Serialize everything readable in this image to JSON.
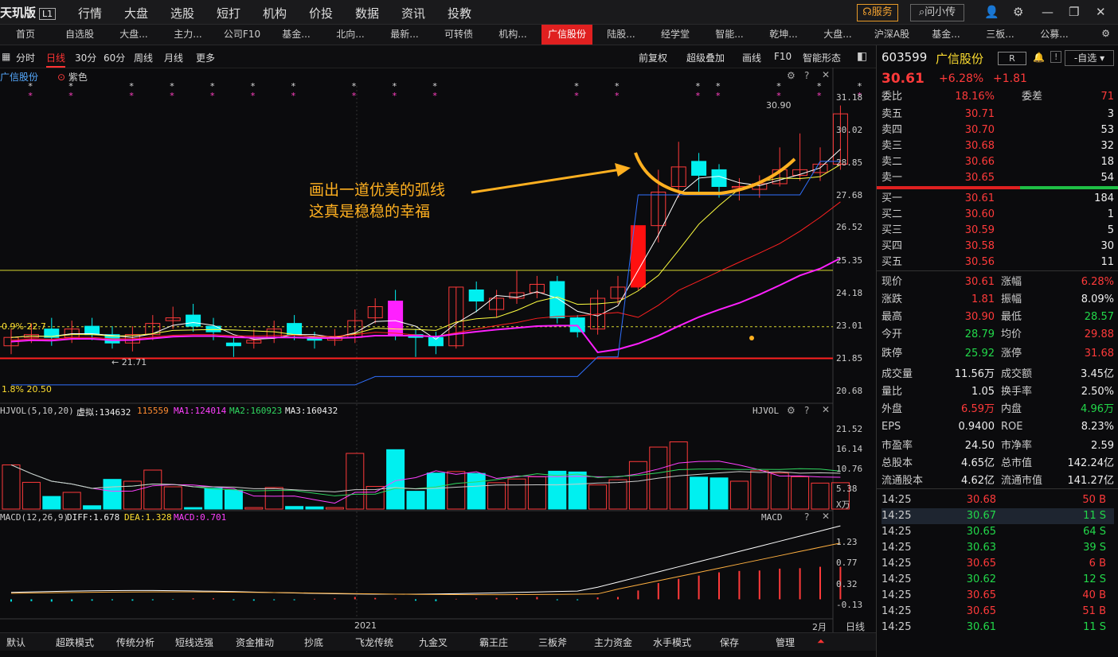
{
  "app": {
    "brand": "天玑版",
    "level": "L1",
    "menu": [
      "行情",
      "大盘",
      "选股",
      "短打",
      "机构",
      "价投",
      "数据",
      "资讯",
      "投教"
    ],
    "service": "服务",
    "ask": "问小传"
  },
  "tabs": [
    "首页",
    "自选股",
    "大盘...",
    "主力...",
    "公司F10",
    "基金...",
    "北向...",
    "最新...",
    "可转债",
    "机构...",
    "广信股份",
    "陆股...",
    "经学堂",
    "智能...",
    "乾坤...",
    "大盘...",
    "沪深A股",
    "基金...",
    "三板...",
    "公募..."
  ],
  "active_tab": "广信股份",
  "toolbar": {
    "periods": [
      "分时",
      "日线",
      "30分",
      "60分",
      "周线",
      "月线",
      "更多"
    ],
    "active": "日线",
    "right": [
      "前复权",
      "超级叠加",
      "画线",
      "F10",
      "智能形态"
    ]
  },
  "chart": {
    "stock": "广信股份",
    "color_mode": "紫色",
    "annotation_line1": "画出一道优美的弧线",
    "annotation_line2": "这真是稳稳的幸福",
    "high_label": "30.90",
    "low_label": "21.71",
    "left_pct1": "0.9% 22.7",
    "left_pct2": "1.8% 20.50",
    "year_label": "2021",
    "month_label": "2月",
    "period_label": "日线",
    "price_ticks": [
      "31.18",
      "30.02",
      "28.85",
      "27.68",
      "26.52",
      "25.35",
      "24.18",
      "23.01",
      "21.85",
      "20.68"
    ],
    "vol": {
      "name": "HJVOL(5,10,20)",
      "virtual": "虚拟:134632",
      "v2": "115559",
      "ma1": "MA1:124014",
      "ma2": "MA2:160923",
      "ma3": "MA3:160432",
      "tag": "HJVOL",
      "ticks": [
        "21.52",
        "16.14",
        "10.76",
        "5.38"
      ],
      "unit": "X万"
    },
    "macd": {
      "name": "MACD(12,26,9)",
      "diff": "DIFF:1.678",
      "dea": "DEA:1.328",
      "macd": "MACD:0.701",
      "tag": "MACD",
      "ticks": [
        "1.23",
        "0.77",
        "0.32",
        "-0.13"
      ]
    }
  },
  "chart_data": {
    "type": "candlestick",
    "candles": [
      {
        "o": 22.3,
        "c": 22.6,
        "h": 22.9,
        "l": 22.0
      },
      {
        "o": 22.6,
        "c": 22.7,
        "h": 23.1,
        "l": 22.4
      },
      {
        "o": 22.9,
        "c": 22.6,
        "h": 23.3,
        "l": 22.3
      },
      {
        "o": 22.6,
        "c": 22.9,
        "h": 23.2,
        "l": 22.4
      },
      {
        "o": 23.0,
        "c": 22.7,
        "h": 23.3,
        "l": 22.5
      },
      {
        "o": 22.7,
        "c": 22.4,
        "h": 23.0,
        "l": 22.2
      },
      {
        "o": 22.4,
        "c": 22.7,
        "h": 23.0,
        "l": 22.1
      },
      {
        "o": 22.7,
        "c": 23.1,
        "h": 23.4,
        "l": 22.5
      },
      {
        "o": 23.2,
        "c": 23.3,
        "h": 23.7,
        "l": 22.9
      },
      {
        "o": 23.4,
        "c": 23.0,
        "h": 23.8,
        "l": 22.8
      },
      {
        "o": 23.0,
        "c": 22.8,
        "h": 23.3,
        "l": 22.5
      },
      {
        "o": 22.4,
        "c": 22.3,
        "h": 22.6,
        "l": 21.9
      },
      {
        "o": 22.4,
        "c": 22.5,
        "h": 22.9,
        "l": 22.2
      },
      {
        "o": 22.6,
        "c": 22.9,
        "h": 23.2,
        "l": 22.4
      },
      {
        "o": 23.1,
        "c": 22.7,
        "h": 23.4,
        "l": 22.5
      },
      {
        "o": 22.6,
        "c": 22.5,
        "h": 22.8,
        "l": 22.2
      },
      {
        "o": 22.5,
        "c": 22.6,
        "h": 22.9,
        "l": 22.3
      },
      {
        "o": 22.6,
        "c": 23.2,
        "h": 23.6,
        "l": 22.4
      },
      {
        "o": 23.3,
        "c": 23.7,
        "h": 24.0,
        "l": 23.1
      },
      {
        "o": 23.9,
        "c": 22.7,
        "h": 24.3,
        "l": 22.5
      },
      {
        "o": 22.7,
        "c": 22.6,
        "h": 22.9,
        "l": 21.9
      },
      {
        "o": 22.6,
        "c": 22.3,
        "h": 22.8,
        "l": 22.0
      },
      {
        "o": 22.3,
        "c": 24.4,
        "h": 24.4,
        "l": 22.2
      },
      {
        "o": 24.3,
        "c": 23.9,
        "h": 24.6,
        "l": 23.5
      },
      {
        "o": 23.6,
        "c": 24.0,
        "h": 24.3,
        "l": 23.3
      },
      {
        "o": 24.0,
        "c": 24.2,
        "h": 25.0,
        "l": 23.8
      },
      {
        "o": 24.2,
        "c": 24.5,
        "h": 24.8,
        "l": 24.0
      },
      {
        "o": 24.6,
        "c": 23.3,
        "h": 24.8,
        "l": 23.1
      },
      {
        "o": 23.3,
        "c": 22.8,
        "h": 23.4,
        "l": 22.6
      },
      {
        "o": 22.9,
        "c": 24.0,
        "h": 24.3,
        "l": 22.7
      },
      {
        "o": 24.0,
        "c": 24.4,
        "h": 24.8,
        "l": 23.8
      },
      {
        "o": 24.4,
        "c": 26.6,
        "h": 26.6,
        "l": 24.3
      },
      {
        "o": 26.6,
        "c": 27.8,
        "h": 28.6,
        "l": 26.0
      },
      {
        "o": 28.0,
        "c": 28.7,
        "h": 29.6,
        "l": 27.6
      },
      {
        "o": 28.9,
        "c": 28.4,
        "h": 29.2,
        "l": 27.8
      },
      {
        "o": 28.6,
        "c": 28.0,
        "h": 28.8,
        "l": 27.6
      },
      {
        "o": 28.0,
        "c": 28.0,
        "h": 28.3,
        "l": 27.5
      },
      {
        "o": 27.9,
        "c": 28.1,
        "h": 28.4,
        "l": 27.6
      },
      {
        "o": 28.1,
        "c": 28.6,
        "h": 29.4,
        "l": 28.0
      },
      {
        "o": 28.4,
        "c": 28.6,
        "h": 29.9,
        "l": 28.2
      },
      {
        "o": 28.5,
        "c": 28.8,
        "h": 29.4,
        "l": 28.2
      },
      {
        "o": 28.8,
        "c": 30.6,
        "h": 30.9,
        "l": 28.6
      }
    ],
    "ylim": [
      20.3,
      31.6
    ],
    "volumes": [
      11.9,
      7.2,
      3.4,
      4.5,
      0.9,
      8.0,
      7.5,
      10.5,
      6.0,
      0.4,
      5.6,
      5.1,
      0.4,
      5.8,
      0.7,
      0.6,
      0.4,
      15.0,
      6.1,
      16.0,
      4.8,
      9.7,
      10.1,
      9.6,
      7.1,
      8.1,
      8.7,
      10.2,
      10.0,
      6.5,
      7.9,
      12.8,
      16.7,
      18.1,
      8.6,
      8.4,
      7.5,
      10.3,
      9.7,
      8.7,
      7.0,
      7.1
    ],
    "vol_filled": [
      true,
      false,
      false,
      false,
      false,
      false,
      false,
      false,
      false,
      false,
      false,
      false,
      false,
      false,
      false,
      false,
      true,
      false,
      false,
      false,
      true,
      false,
      true,
      false,
      false,
      false,
      false,
      false,
      false,
      false,
      false,
      false,
      false,
      false,
      false,
      true,
      true,
      false,
      false,
      false,
      false,
      false
    ],
    "vol_ylim": [
      0,
      24
    ],
    "macd_bars": [
      -0.05,
      -0.04,
      -0.05,
      -0.04,
      -0.03,
      -0.02,
      -0.03,
      -0.02,
      -0.01,
      0.02,
      0.02,
      -0.02,
      -0.03,
      -0.02,
      -0.02,
      0.01,
      0.02,
      0.05,
      0.03,
      0.02,
      -0.03,
      -0.04,
      0.01,
      0.02,
      0.03,
      0.03,
      0.05,
      -0.02,
      -0.02,
      0.04,
      0.05,
      0.19,
      0.35,
      0.44,
      0.51,
      0.58,
      0.61,
      0.62,
      0.66,
      0.67,
      0.7,
      0.7
    ],
    "macd_ylim": [
      -0.42,
      1.6
    ]
  },
  "quote": {
    "code": "603599",
    "name": "广信股份",
    "badge": "R",
    "self_btn": "-自选",
    "price": "30.61",
    "chg_pct": "+6.28%",
    "chg": "+1.81",
    "weibi_label": "委比",
    "weibi": "18.16%",
    "weicha_label": "委差",
    "weicha": "71",
    "asks": [
      {
        "l": "卖五",
        "p": "30.71",
        "v": "3"
      },
      {
        "l": "卖四",
        "p": "30.70",
        "v": "53"
      },
      {
        "l": "卖三",
        "p": "30.68",
        "v": "32"
      },
      {
        "l": "卖二",
        "p": "30.66",
        "v": "18"
      },
      {
        "l": "卖一",
        "p": "30.65",
        "v": "54"
      }
    ],
    "bids": [
      {
        "l": "买一",
        "p": "30.61",
        "v": "184"
      },
      {
        "l": "买二",
        "p": "30.60",
        "v": "1"
      },
      {
        "l": "买三",
        "p": "30.59",
        "v": "5"
      },
      {
        "l": "买四",
        "p": "30.58",
        "v": "30"
      },
      {
        "l": "买五",
        "p": "30.56",
        "v": "11"
      }
    ],
    "stats": [
      {
        "l1": "现价",
        "v1": "30.61",
        "c1": "red",
        "l2": "涨幅",
        "v2": "6.28%",
        "c2": "red"
      },
      {
        "l1": "涨跌",
        "v1": "1.81",
        "c1": "red",
        "l2": "振幅",
        "v2": "8.09%",
        "c2": "white"
      },
      {
        "l1": "最高",
        "v1": "30.90",
        "c1": "red",
        "l2": "最低",
        "v2": "28.57",
        "c2": "green"
      },
      {
        "l1": "今开",
        "v1": "28.79",
        "c1": "green",
        "l2": "均价",
        "v2": "29.88",
        "c2": "red"
      },
      {
        "l1": "跌停",
        "v1": "25.92",
        "c1": "green",
        "l2": "涨停",
        "v2": "31.68",
        "c2": "red"
      },
      {
        "l1": "成交量",
        "v1": "11.56万",
        "c1": "white",
        "l2": "成交额",
        "v2": "3.45亿",
        "c2": "white"
      },
      {
        "l1": "量比",
        "v1": "1.05",
        "c1": "white",
        "l2": "换手率",
        "v2": "2.50%",
        "c2": "white"
      },
      {
        "l1": "外盘",
        "v1": "6.59万",
        "c1": "red",
        "l2": "内盘",
        "v2": "4.96万",
        "c2": "green"
      },
      {
        "l1": "EPS",
        "v1": "0.9400",
        "c1": "white",
        "l2": "ROE",
        "v2": "8.23%",
        "c2": "white"
      },
      {
        "l1": "市盈率",
        "v1": "24.50",
        "c1": "white",
        "l2": "市净率",
        "v2": "2.59",
        "c2": "white"
      },
      {
        "l1": "总股本",
        "v1": "4.65亿",
        "c1": "white",
        "l2": "总市值",
        "v2": "142.24亿",
        "c2": "white"
      },
      {
        "l1": "流通股本",
        "v1": "4.62亿",
        "c1": "white",
        "l2": "流通市值",
        "v2": "141.27亿",
        "c2": "white"
      }
    ],
    "ticks": [
      {
        "t": "14:25",
        "p": "30.68",
        "v": "50 B",
        "c": "red"
      },
      {
        "t": "14:25",
        "p": "30.67",
        "v": "11 S",
        "c": "green"
      },
      {
        "t": "14:25",
        "p": "30.65",
        "v": "64 S",
        "c": "green"
      },
      {
        "t": "14:25",
        "p": "30.63",
        "v": "39 S",
        "c": "green"
      },
      {
        "t": "14:25",
        "p": "30.65",
        "v": "6 B",
        "c": "red"
      },
      {
        "t": "14:25",
        "p": "30.62",
        "v": "12 S",
        "c": "green"
      },
      {
        "t": "14:25",
        "p": "30.65",
        "v": "40 B",
        "c": "red"
      },
      {
        "t": "14:25",
        "p": "30.65",
        "v": "51 B",
        "c": "red"
      },
      {
        "t": "14:25",
        "p": "30.61",
        "v": "11 S",
        "c": "green"
      }
    ]
  },
  "bottom": [
    "默认",
    "超跌模式",
    "传统分析",
    "短线选强",
    "资金推动",
    "抄底",
    "飞龙传统",
    "九金叉",
    "霸王庄",
    "三板斧",
    "主力资金",
    "水手模式",
    "保存",
    "管理"
  ],
  "colors": {
    "up": "#ff3a3a",
    "down": "#22d84a",
    "candle_up_fill": "#00f0f0",
    "accent": "#e02020",
    "annot": "#ffb020"
  }
}
